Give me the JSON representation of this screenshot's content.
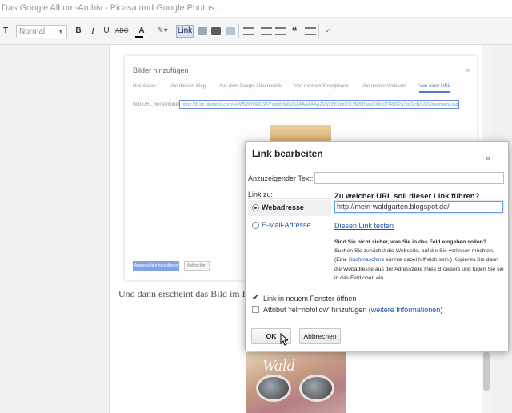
{
  "window": {
    "title": "Das Google Album-Archiv - Picasa und Google Photos ..."
  },
  "toolbar": {
    "font_icon": "T",
    "format_select": "Normal",
    "bold_label": "B",
    "italic_label": "I",
    "underline_label": "U",
    "strike_label": "ABC",
    "textcolor_label": "A",
    "link_label": "Link"
  },
  "editor": {
    "text": "Und dann erscheint das Bild im Blog"
  },
  "bg_dialog": {
    "title": "Bilder hinzufügen",
    "close": "×",
    "tabs": [
      "Hochladen",
      "Von diesem Blog",
      "Aus dem Google Albumarchiv",
      "Von meinem Smartphone",
      "Von meiner Webcam",
      "Von einer URL"
    ],
    "url_label": "Bild-URL hier einfügen:",
    "url_value": "https://lh.bp.blogspot.com/-esW52Ph8HQ/AV7sgbtfyM6s/AAAAAAAAA26/aVi3K9mtO7UfMBTbwsDXIhlDTIR80Pa7wCLcB/s320/geertsens.jpg",
    "add_button": "Ausgewählte hinzufügen",
    "cancel_button": "Abbrechen"
  },
  "dialog": {
    "title": "Link bearbeiten",
    "close": "×",
    "text_label": "Anzuzeigender Text:",
    "text_value": "",
    "link_to_label": "Link zu:",
    "options": [
      {
        "label": "Webadresse",
        "selected": true
      },
      {
        "label": "E-Mail-Adresse",
        "selected": false
      }
    ],
    "url_question": "Zu welcher URL soll dieser Link führen?",
    "url_value": "http://mein-waldgarten.blogspot.de/",
    "test_link": "Diesen Link testen",
    "help": {
      "bold": "Sind Sie nicht sicher, was Sie in das Feld eingeben sollen?",
      "part1": " Suchen Sie zunächst die Webseite, auf die Sie verlinken möchten. (Eine ",
      "link": "Suchmaschine",
      "part2": " könnte dabei hilfreich sein.) Kopieren Sie dann die Webadresse aus der Adresszeile Ihres Browsers und fügen Sie sie in das Feld oben ein."
    },
    "new_window": {
      "label": "Link in neuem Fenster öffnen",
      "checked": true
    },
    "nofollow": {
      "label": "Attribut 'rel=nofollow' hinzufügen (",
      "link": "weitere Informationen",
      "suffix": ")",
      "checked": false
    },
    "ok_button": "OK",
    "cancel_button": "Abbrechen"
  },
  "photo": {
    "overlay_text": "Wald"
  }
}
